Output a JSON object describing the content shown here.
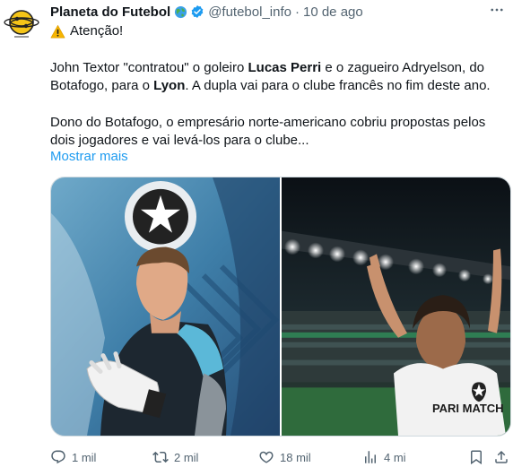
{
  "author": {
    "name": "Planeta do Futebol",
    "handle": "@futebol_info",
    "date": "10 de ago"
  },
  "tweet": {
    "alert_text": "Atenção!",
    "p1_a": "John Textor \"contratou\" o goleiro ",
    "p1_b": "Lucas Perri",
    "p1_c": " e o zagueiro Adryelson, do Botafogo, para o ",
    "p1_d": "Lyon",
    "p1_e": ". A dupla vai para o clube francês no fim deste ano.",
    "p2": "Dono do Botafogo, o empresário norte-americano cobriu propostas pelos dois jogadores e vai levá-los para o clube...",
    "show_more": "Mostrar mais"
  },
  "media": {
    "left_image": "goalkeeper-photo",
    "right_image": "stadium-player-photo",
    "sponsor_text": "PARI MATCH"
  },
  "stats": {
    "replies": "1 mil",
    "reposts": "2 mil",
    "likes": "18 mil",
    "views": "4 mi"
  },
  "icons": {
    "more": "more-icon",
    "reply": "reply-icon",
    "repost": "repost-icon",
    "like": "heart-icon",
    "views": "views-icon",
    "bookmark": "bookmark-icon",
    "share": "share-icon"
  },
  "colors": {
    "link": "#1d9bf0",
    "muted": "#536471",
    "verified": "#1d9bf0"
  }
}
